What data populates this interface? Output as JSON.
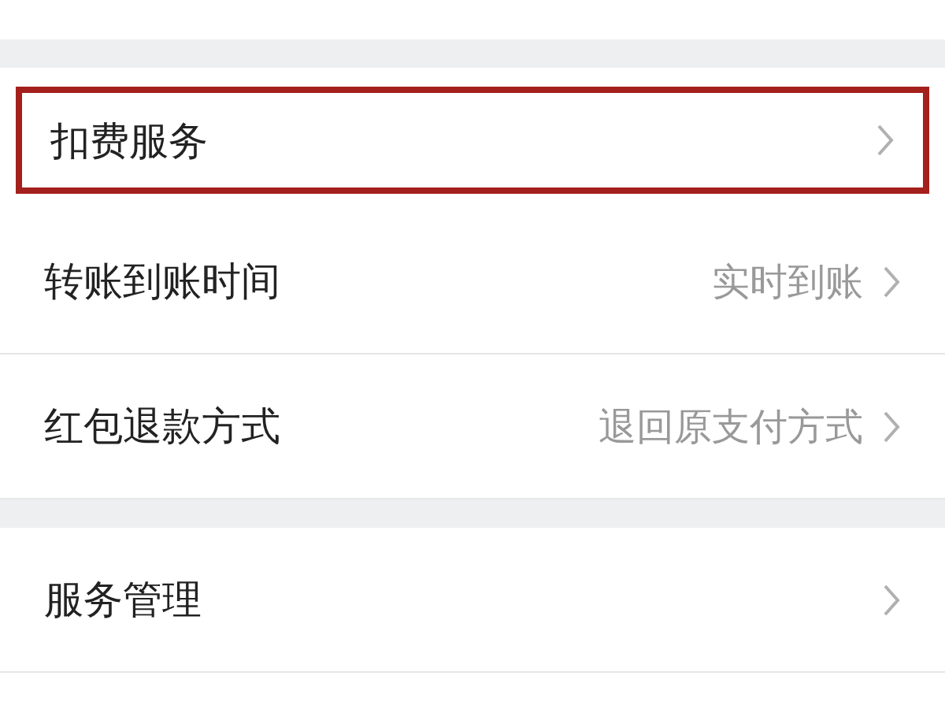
{
  "sections": [
    {
      "items": [
        {
          "label": "扣费服务",
          "highlighted": true
        },
        {
          "label": "转账到账时间",
          "value": "实时到账",
          "highlighted": false
        },
        {
          "label": "红包退款方式",
          "value": "退回原支付方式",
          "highlighted": false
        }
      ]
    },
    {
      "items": [
        {
          "label": "服务管理",
          "highlighted": false
        }
      ]
    }
  ]
}
